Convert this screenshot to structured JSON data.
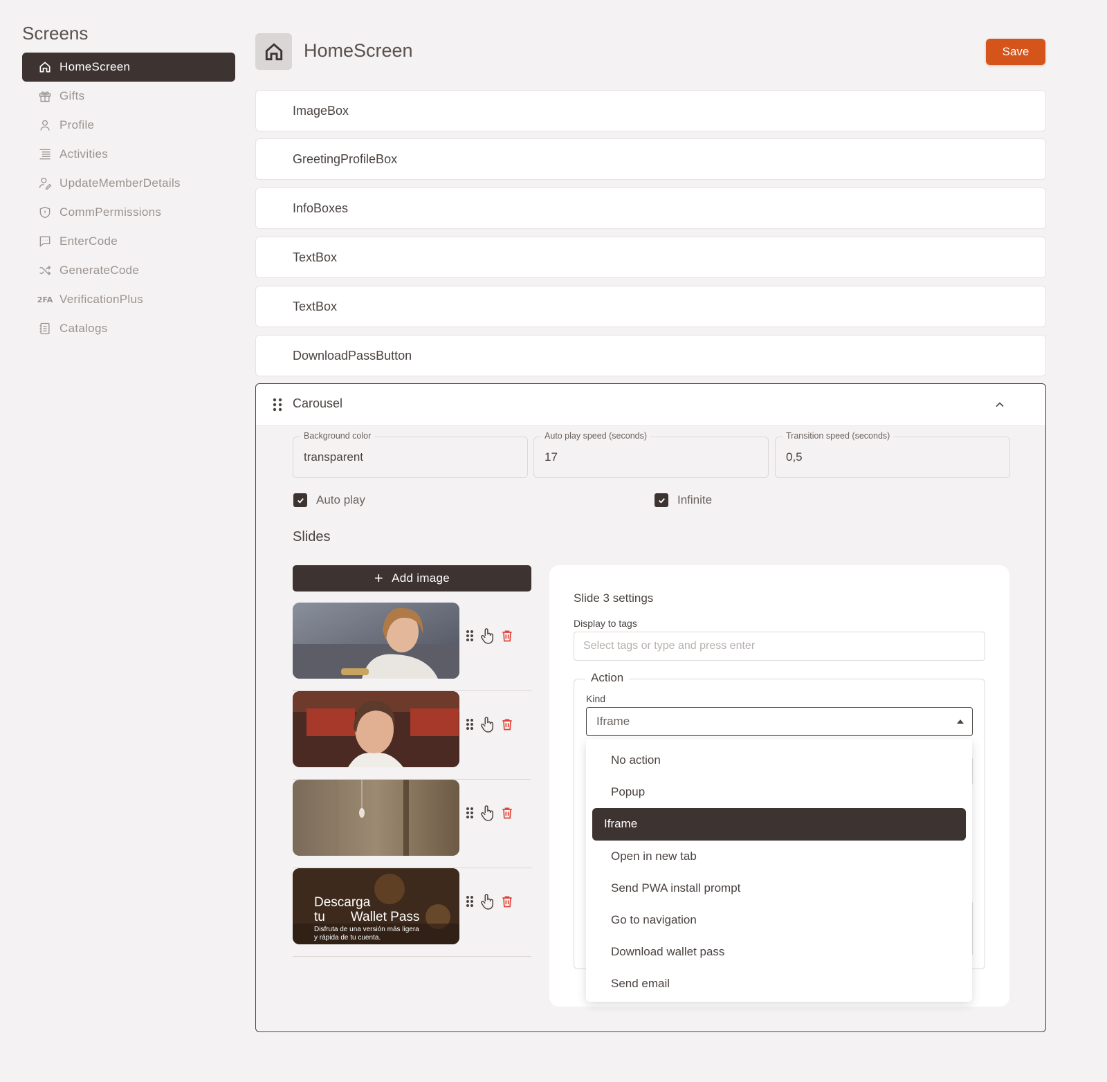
{
  "sidebar": {
    "title": "Screens",
    "items": [
      {
        "label": "HomeScreen",
        "icon": "home-icon",
        "active": true
      },
      {
        "label": "Gifts",
        "icon": "gift-icon"
      },
      {
        "label": "Profile",
        "icon": "user-icon"
      },
      {
        "label": "Activities",
        "icon": "list-icon"
      },
      {
        "label": "UpdateMemberDetails",
        "icon": "user-edit-icon"
      },
      {
        "label": "CommPermissions",
        "icon": "shield-icon"
      },
      {
        "label": "EnterCode",
        "icon": "message-icon"
      },
      {
        "label": "GenerateCode",
        "icon": "shuffle-icon"
      },
      {
        "label": "VerificationPlus",
        "icon": "2fa-icon",
        "icon_text": "2FA"
      },
      {
        "label": "Catalogs",
        "icon": "catalog-icon"
      }
    ]
  },
  "header": {
    "title": "HomeScreen",
    "save_label": "Save"
  },
  "components": [
    "ImageBox",
    "GreetingProfileBox",
    "InfoBoxes",
    "TextBox",
    "TextBox",
    "DownloadPassButton"
  ],
  "carousel": {
    "title": "Carousel",
    "fields": {
      "background_color": {
        "label": "Background color",
        "value": "transparent"
      },
      "auto_play_speed": {
        "label": "Auto play speed (seconds)",
        "value": "17"
      },
      "transition_speed": {
        "label": "Transition speed (seconds)",
        "value": "0,5"
      }
    },
    "auto_play_label": "Auto play",
    "infinite_label": "Infinite",
    "slides_title": "Slides",
    "add_image_label": "Add image",
    "slide4_text": {
      "line1": "Descarga",
      "line2a": "tu",
      "line2b": "Wallet Pass",
      "line3": "Disfruta de una versión más ligera",
      "line4": "y rápida de tu cuenta."
    }
  },
  "slide_settings": {
    "title": "Slide 3 settings",
    "tags_label": "Display to tags",
    "tags_placeholder": "Select tags or type and press enter",
    "action_legend": "Action",
    "kind_label": "Kind",
    "kind_value": "Iframe"
  },
  "dropdown": {
    "options": [
      "No action",
      "Popup",
      "Iframe",
      "Open in new tab",
      "Send PWA install prompt",
      "Go to navigation",
      "Download wallet pass",
      "Send email"
    ],
    "selected": "Iframe"
  },
  "colors": {
    "accent": "#d4541a",
    "dark": "#3d3331",
    "danger": "#e0433a",
    "background": "#f4f2f2"
  }
}
